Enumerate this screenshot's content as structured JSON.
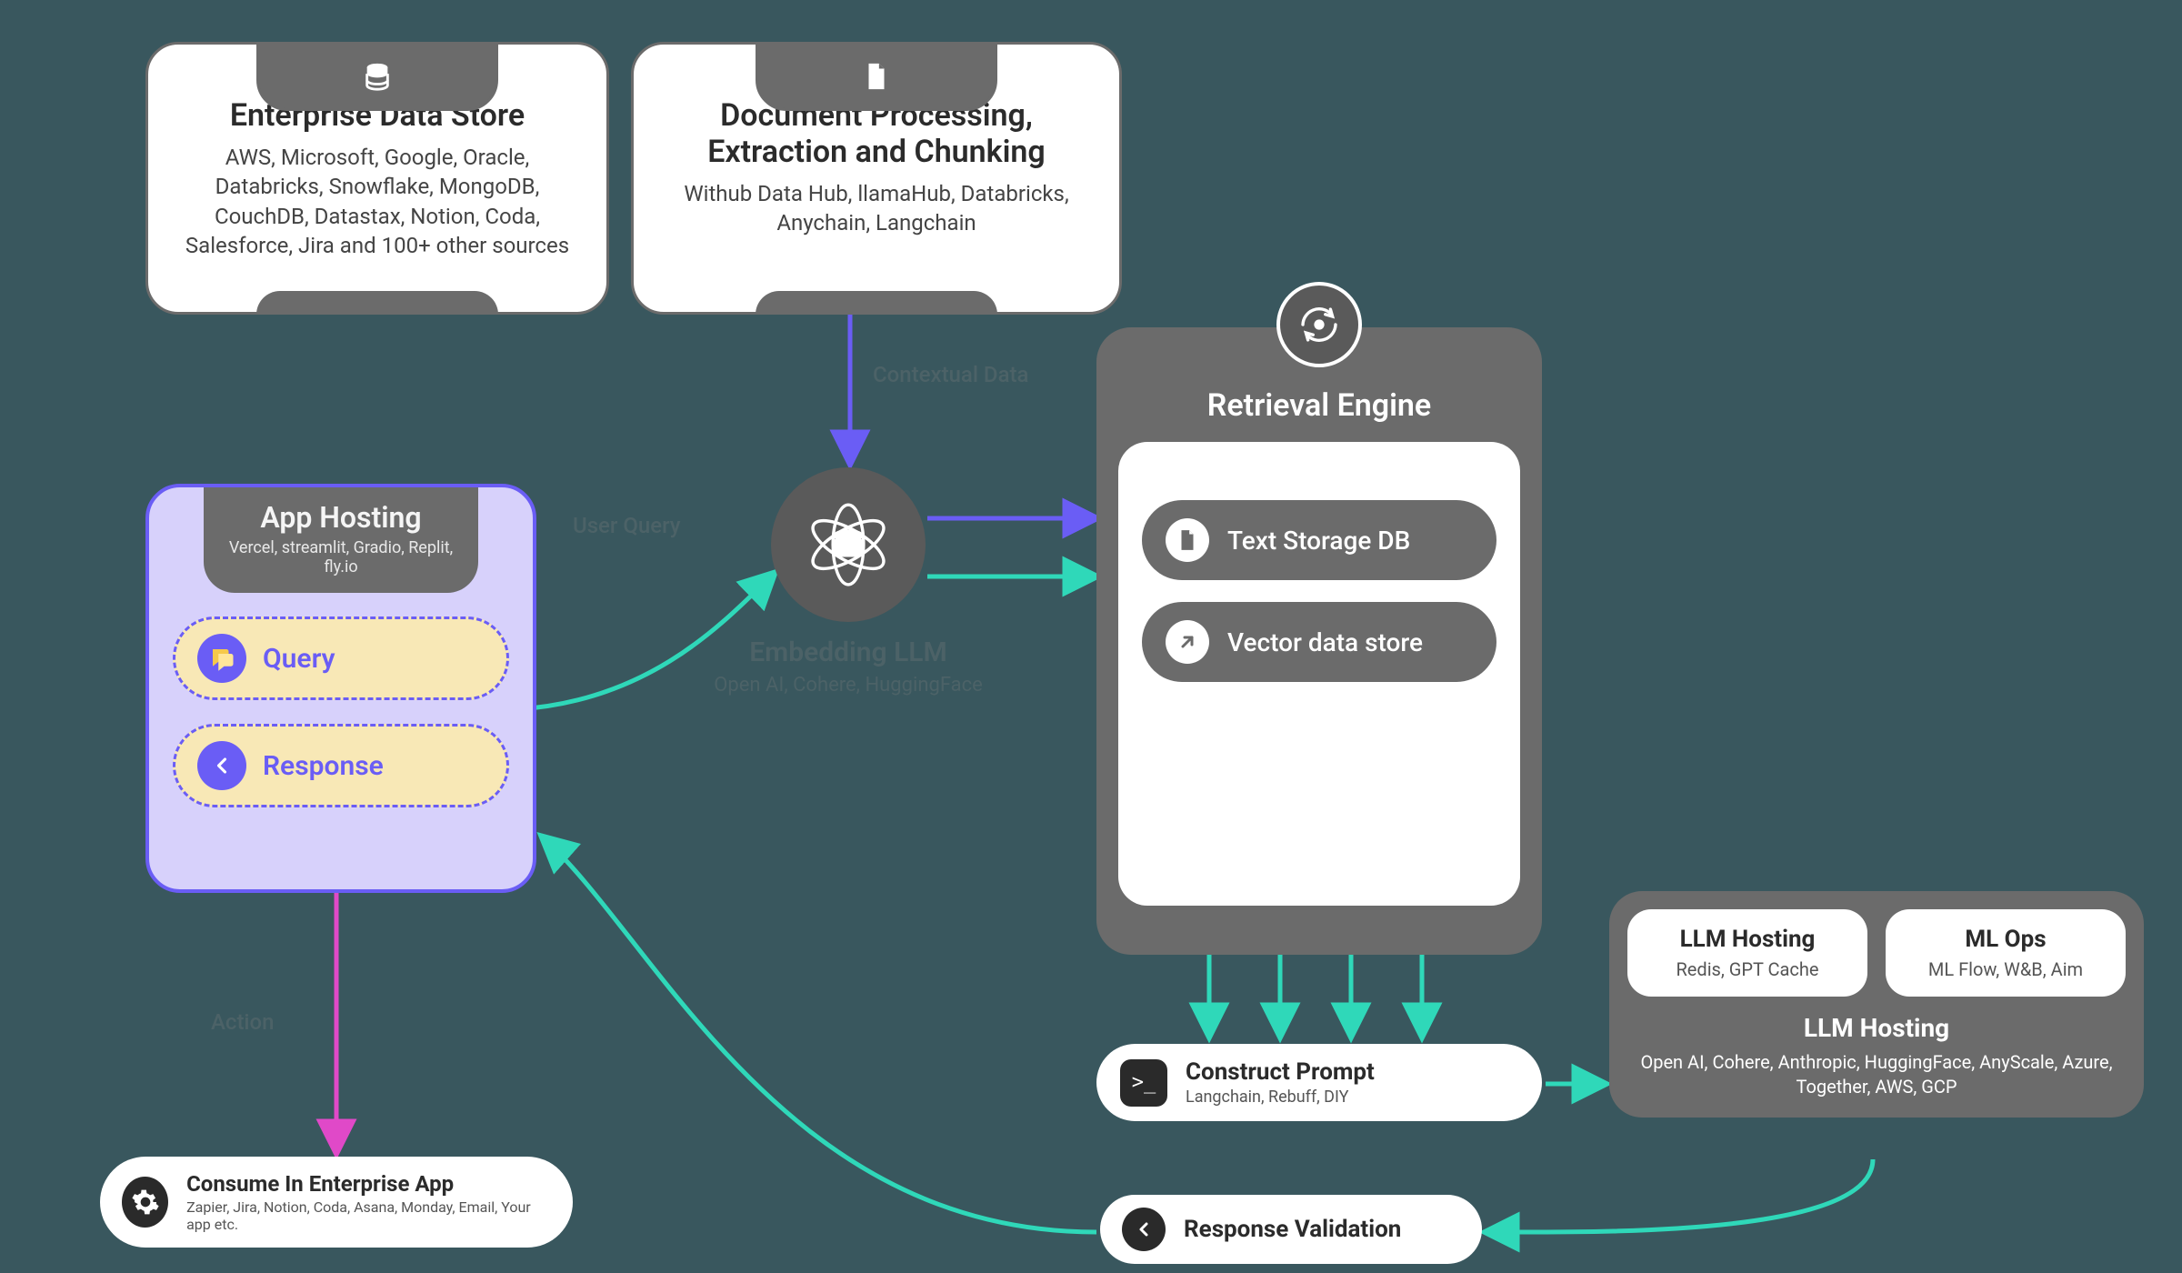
{
  "diagram": {
    "enterprise_data_store": {
      "title": "Enterprise Data Store",
      "description": "AWS, Microsoft, Google, Oracle, Databricks, Snowflake, MongoDB, CouchDB, Datastax, Notion, Coda, Salesforce, Jira and 100+ other sources",
      "icon": "database-stack-icon"
    },
    "document_processing": {
      "title": "Document Processing, Extraction and Chunking",
      "description": "Withub Data Hub, llamaHub, Databricks, Anychain, Langchain",
      "icon": "document-icon"
    },
    "app_hosting": {
      "title": "App Hosting",
      "description": "Vercel, streamlit, Gradio, Replit, fly.io",
      "query_label": "Query",
      "response_label": "Response"
    },
    "embedding": {
      "title": "Embedding LLM",
      "description": "Open AI, Cohere, HuggingFace",
      "icon": "embedding-atom-icon"
    },
    "retrieval_engine": {
      "title": "Retrieval Engine",
      "icon": "refresh-gear-icon",
      "text_storage_label": "Text Storage DB",
      "vector_store_label": "Vector data store"
    },
    "construct_prompt": {
      "title": "Construct Prompt",
      "description": "Langchain, Rebuff, DIY",
      "icon": "terminal-icon"
    },
    "llm_hosting_panel": {
      "cache": {
        "title": "LLM Hosting",
        "description": "Redis, GPT Cache"
      },
      "mlops": {
        "title": "ML Ops",
        "description": "ML Flow, W&B, Aim"
      },
      "main": {
        "title": "LLM Hosting",
        "description": "Open AI, Cohere, Anthropic, HuggingFace, AnyScale, Azure, Together, AWS, GCP"
      }
    },
    "response_validation": {
      "label": "Response Validation",
      "icon": "arrow-left-icon"
    },
    "consume_app": {
      "title": "Consume In Enterprise App",
      "description": "Zapier, Jira, Notion, Coda, Asana, Monday, Email, Your app etc.",
      "icon": "gear-icon"
    },
    "edges": {
      "contextual_data": "Contextual Data",
      "user_query": "User Query",
      "action": "Action"
    }
  },
  "colors": {
    "teal": "#2fd8b9",
    "purple": "#6a5df5",
    "magenta": "#e049c8"
  }
}
